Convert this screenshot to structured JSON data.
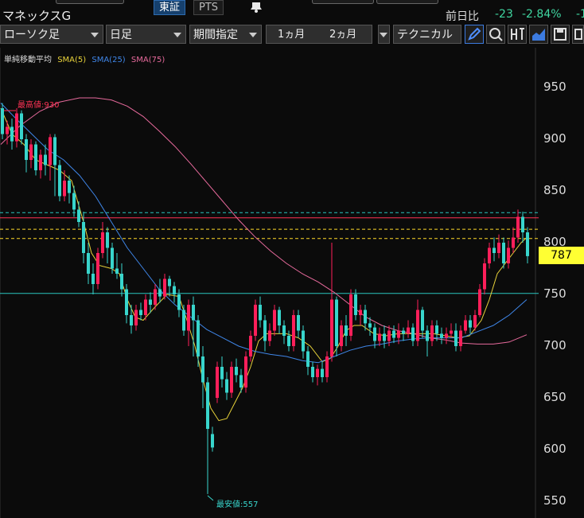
{
  "app": {
    "title": "マネックスG"
  },
  "market_tabs": [
    {
      "label": "東証",
      "active": true
    },
    {
      "label": "PTS",
      "active": false
    }
  ],
  "quote": {
    "change_label": "前日比",
    "change": "-23",
    "change_pct": "-2.84%",
    "cut_text": "-1"
  },
  "toolbar": {
    "chart_type": "ローソク足",
    "interval": "日足",
    "period_mode": "期間指定",
    "range_1": "1ヵ月",
    "range_2": "2ヵ月",
    "technical": "テクニカル",
    "icons": [
      "pencil-icon",
      "zoom-icon",
      "exit-icon",
      "area-chart-icon",
      "save-icon",
      "grid-icon"
    ]
  },
  "legend": {
    "label": "単純移動平均",
    "items": [
      {
        "name": "SMA(5)",
        "color": "#e8d23a"
      },
      {
        "name": "SMA(25)",
        "color": "#3f86e8"
      },
      {
        "name": "SMA(75)",
        "color": "#e76a9c"
      }
    ]
  },
  "annotations": {
    "high": "最高値:930",
    "low": "最安値:557"
  },
  "price_tag": "787",
  "colors": {
    "up": "#ff1f5a",
    "down": "#38d5cc",
    "bg": "#0b0b0b",
    "grid": "#1e1e1e"
  },
  "chart_data": {
    "type": "candlestick",
    "title": "",
    "xlabel": "",
    "ylabel": "",
    "ylim": [
      540,
      980
    ],
    "yticks": [
      "950",
      "900",
      "850",
      "800",
      "750",
      "700",
      "650",
      "600",
      "550"
    ],
    "current_price": 787,
    "high": 930,
    "low": 557,
    "hlines": [
      {
        "value": 829,
        "color": "#2bc6c0",
        "style": "dash"
      },
      {
        "value": 824,
        "color": "#ff3355",
        "style": "solid"
      },
      {
        "value": 813,
        "color": "#ffd92a",
        "style": "dash"
      },
      {
        "value": 804,
        "color": "#ffd92a",
        "style": "dash"
      },
      {
        "value": 751,
        "color": "#2bc6c0",
        "style": "solid"
      }
    ],
    "series": [
      {
        "name": "SMA(5)",
        "color": "#e8d23a",
        "values": [
          [
            1,
            930
          ],
          [
            15,
            905
          ],
          [
            30,
            895
          ],
          [
            45,
            880
          ],
          [
            60,
            875
          ],
          [
            75,
            870
          ],
          [
            90,
            860
          ],
          [
            105,
            820
          ],
          [
            115,
            790
          ],
          [
            125,
            778
          ],
          [
            140,
            775
          ],
          [
            150,
            770
          ],
          [
            160,
            745
          ],
          [
            170,
            728
          ],
          [
            180,
            725
          ],
          [
            195,
            738
          ],
          [
            210,
            750
          ],
          [
            225,
            748
          ],
          [
            235,
            725
          ],
          [
            245,
            700
          ],
          [
            255,
            668
          ],
          [
            265,
            640
          ],
          [
            275,
            628
          ],
          [
            285,
            630
          ],
          [
            295,
            645
          ],
          [
            305,
            660
          ],
          [
            315,
            680
          ],
          [
            325,
            705
          ],
          [
            335,
            712
          ],
          [
            345,
            712
          ],
          [
            360,
            712
          ],
          [
            375,
            708
          ],
          [
            390,
            700
          ],
          [
            405,
            685
          ],
          [
            415,
            688
          ],
          [
            425,
            700
          ],
          [
            435,
            715
          ],
          [
            445,
            720
          ],
          [
            455,
            720
          ],
          [
            470,
            712
          ],
          [
            485,
            710
          ],
          [
            500,
            712
          ],
          [
            515,
            712
          ],
          [
            530,
            712
          ],
          [
            545,
            712
          ],
          [
            560,
            710
          ],
          [
            575,
            708
          ],
          [
            590,
            710
          ],
          [
            605,
            725
          ],
          [
            615,
            745
          ],
          [
            625,
            770
          ],
          [
            635,
            780
          ],
          [
            645,
            790
          ],
          [
            655,
            800
          ],
          [
            662,
            805
          ]
        ]
      },
      {
        "name": "SMA(25)",
        "color": "#3f86e8",
        "values": [
          [
            1,
            935
          ],
          [
            20,
            920
          ],
          [
            40,
            905
          ],
          [
            60,
            890
          ],
          [
            80,
            880
          ],
          [
            100,
            865
          ],
          [
            120,
            845
          ],
          [
            140,
            820
          ],
          [
            160,
            795
          ],
          [
            180,
            775
          ],
          [
            200,
            755
          ],
          [
            220,
            740
          ],
          [
            240,
            728
          ],
          [
            260,
            716
          ],
          [
            280,
            708
          ],
          [
            300,
            700
          ],
          [
            320,
            695
          ],
          [
            340,
            692
          ],
          [
            360,
            690
          ],
          [
            380,
            686
          ],
          [
            400,
            684
          ],
          [
            420,
            690
          ],
          [
            440,
            696
          ],
          [
            460,
            700
          ],
          [
            480,
            702
          ],
          [
            500,
            705
          ],
          [
            520,
            707
          ],
          [
            540,
            708
          ],
          [
            560,
            708
          ],
          [
            580,
            708
          ],
          [
            600,
            714
          ],
          [
            620,
            720
          ],
          [
            640,
            730
          ],
          [
            662,
            745
          ]
        ]
      },
      {
        "name": "SMA(75)",
        "color": "#e76a9c",
        "values": [
          [
            1,
            895
          ],
          [
            25,
            913
          ],
          [
            50,
            927
          ],
          [
            75,
            936
          ],
          [
            100,
            940
          ],
          [
            120,
            940
          ],
          [
            140,
            938
          ],
          [
            160,
            932
          ],
          [
            180,
            922
          ],
          [
            200,
            908
          ],
          [
            220,
            893
          ],
          [
            240,
            876
          ],
          [
            260,
            858
          ],
          [
            280,
            840
          ],
          [
            300,
            822
          ],
          [
            320,
            806
          ],
          [
            340,
            792
          ],
          [
            360,
            780
          ],
          [
            380,
            770
          ],
          [
            400,
            762
          ],
          [
            420,
            752
          ],
          [
            440,
            740
          ],
          [
            460,
            728
          ],
          [
            480,
            720
          ],
          [
            500,
            715
          ],
          [
            520,
            712
          ],
          [
            540,
            708
          ],
          [
            560,
            706
          ],
          [
            580,
            703
          ],
          [
            600,
            702
          ],
          [
            620,
            702
          ],
          [
            640,
            704
          ],
          [
            662,
            711
          ]
        ]
      }
    ],
    "candles": [
      [
        3,
        930,
        905,
        935,
        900
      ],
      [
        9,
        905,
        912,
        918,
        895
      ],
      [
        15,
        912,
        898,
        920,
        890
      ],
      [
        21,
        898,
        925,
        930,
        892
      ],
      [
        27,
        925,
        900,
        928,
        895
      ],
      [
        33,
        900,
        880,
        905,
        868
      ],
      [
        39,
        880,
        895,
        900,
        872
      ],
      [
        45,
        895,
        870,
        898,
        865
      ],
      [
        51,
        870,
        885,
        890,
        862
      ],
      [
        57,
        885,
        875,
        895,
        865
      ],
      [
        63,
        875,
        902,
        905,
        860
      ],
      [
        69,
        902,
        875,
        905,
        845
      ],
      [
        75,
        875,
        845,
        880,
        840
      ],
      [
        81,
        845,
        860,
        870,
        840
      ],
      [
        87,
        860,
        848,
        865,
        838
      ],
      [
        93,
        848,
        832,
        855,
        825
      ],
      [
        99,
        832,
        820,
        840,
        815
      ],
      [
        105,
        820,
        790,
        830,
        780
      ],
      [
        111,
        790,
        770,
        800,
        760
      ],
      [
        117,
        770,
        760,
        780,
        750
      ],
      [
        123,
        760,
        790,
        795,
        755
      ],
      [
        129,
        790,
        810,
        820,
        785
      ],
      [
        135,
        810,
        795,
        815,
        780
      ],
      [
        141,
        795,
        775,
        800,
        770
      ],
      [
        147,
        775,
        770,
        790,
        765
      ],
      [
        153,
        770,
        755,
        780,
        748
      ],
      [
        159,
        755,
        730,
        760,
        722
      ],
      [
        165,
        730,
        720,
        740,
        712
      ],
      [
        171,
        720,
        735,
        740,
        715
      ],
      [
        177,
        735,
        730,
        742,
        725
      ],
      [
        183,
        730,
        745,
        750,
        725
      ],
      [
        189,
        745,
        740,
        752,
        732
      ],
      [
        195,
        740,
        755,
        760,
        735
      ],
      [
        201,
        755,
        748,
        765,
        742
      ],
      [
        207,
        748,
        765,
        770,
        745
      ],
      [
        213,
        765,
        758,
        768,
        748
      ],
      [
        219,
        758,
        750,
        762,
        742
      ],
      [
        225,
        750,
        735,
        755,
        728
      ],
      [
        231,
        735,
        715,
        740,
        710
      ],
      [
        237,
        715,
        740,
        745,
        700
      ],
      [
        243,
        740,
        725,
        748,
        690
      ],
      [
        249,
        725,
        690,
        730,
        680
      ],
      [
        255,
        690,
        665,
        700,
        640
      ],
      [
        261,
        665,
        620,
        670,
        557
      ],
      [
        267,
        615,
        602,
        622,
        598
      ],
      [
        273,
        650,
        680,
        685,
        645
      ],
      [
        279,
        680,
        668,
        690,
        660
      ],
      [
        285,
        668,
        655,
        675,
        648
      ],
      [
        291,
        655,
        680,
        685,
        650
      ],
      [
        297,
        680,
        672,
        688,
        665
      ],
      [
        303,
        672,
        660,
        678,
        655
      ],
      [
        309,
        660,
        690,
        695,
        655
      ],
      [
        315,
        690,
        710,
        715,
        685
      ],
      [
        321,
        710,
        740,
        745,
        705
      ],
      [
        327,
        740,
        725,
        748,
        718
      ],
      [
        333,
        725,
        705,
        730,
        695
      ],
      [
        339,
        705,
        715,
        722,
        700
      ],
      [
        345,
        715,
        735,
        740,
        710
      ],
      [
        351,
        735,
        720,
        738,
        712
      ],
      [
        357,
        720,
        710,
        725,
        702
      ],
      [
        363,
        710,
        700,
        715,
        695
      ],
      [
        369,
        700,
        730,
        735,
        695
      ],
      [
        375,
        730,
        715,
        735,
        708
      ],
      [
        381,
        715,
        695,
        720,
        688
      ],
      [
        387,
        695,
        680,
        700,
        672
      ],
      [
        393,
        680,
        670,
        685,
        665
      ],
      [
        399,
        670,
        678,
        682,
        662
      ],
      [
        405,
        678,
        670,
        685,
        665
      ],
      [
        411,
        670,
        690,
        695,
        665
      ],
      [
        417,
        690,
        745,
        800,
        685
      ],
      [
        423,
        745,
        700,
        748,
        690
      ],
      [
        429,
        700,
        720,
        725,
        695
      ],
      [
        435,
        720,
        710,
        730,
        700
      ],
      [
        441,
        710,
        750,
        755,
        705
      ],
      [
        447,
        750,
        730,
        755,
        725
      ],
      [
        453,
        730,
        735,
        740,
        720
      ],
      [
        459,
        735,
        722,
        740,
        715
      ],
      [
        465,
        722,
        718,
        728,
        710
      ],
      [
        471,
        718,
        705,
        722,
        698
      ],
      [
        477,
        705,
        712,
        718,
        700
      ],
      [
        483,
        712,
        705,
        720,
        698
      ],
      [
        489,
        705,
        715,
        720,
        700
      ],
      [
        495,
        715,
        708,
        720,
        703
      ],
      [
        501,
        708,
        715,
        722,
        702
      ],
      [
        507,
        715,
        712,
        718,
        705
      ],
      [
        513,
        712,
        718,
        725,
        708
      ],
      [
        519,
        718,
        705,
        722,
        700
      ],
      [
        525,
        705,
        735,
        745,
        700
      ],
      [
        531,
        735,
        715,
        738,
        708
      ],
      [
        537,
        715,
        705,
        720,
        690
      ],
      [
        543,
        705,
        720,
        725,
        700
      ],
      [
        549,
        720,
        712,
        725,
        705
      ],
      [
        555,
        712,
        708,
        718,
        702
      ],
      [
        561,
        708,
        712,
        718,
        702
      ],
      [
        567,
        712,
        715,
        722,
        708
      ],
      [
        573,
        715,
        700,
        722,
        695
      ],
      [
        579,
        700,
        715,
        720,
        695
      ],
      [
        585,
        715,
        725,
        730,
        712
      ],
      [
        591,
        725,
        718,
        730,
        712
      ],
      [
        597,
        718,
        730,
        735,
        715
      ],
      [
        603,
        730,
        755,
        760,
        728
      ],
      [
        609,
        755,
        780,
        785,
        750
      ],
      [
        615,
        780,
        795,
        800,
        775
      ],
      [
        621,
        795,
        790,
        805,
        782
      ],
      [
        627,
        790,
        800,
        808,
        785
      ],
      [
        633,
        800,
        780,
        805,
        775
      ],
      [
        639,
        780,
        795,
        802,
        775
      ],
      [
        645,
        795,
        805,
        815,
        790
      ],
      [
        651,
        805,
        825,
        832,
        800
      ],
      [
        657,
        825,
        810,
        830,
        800
      ],
      [
        663,
        810,
        787,
        815,
        780
      ]
    ]
  }
}
